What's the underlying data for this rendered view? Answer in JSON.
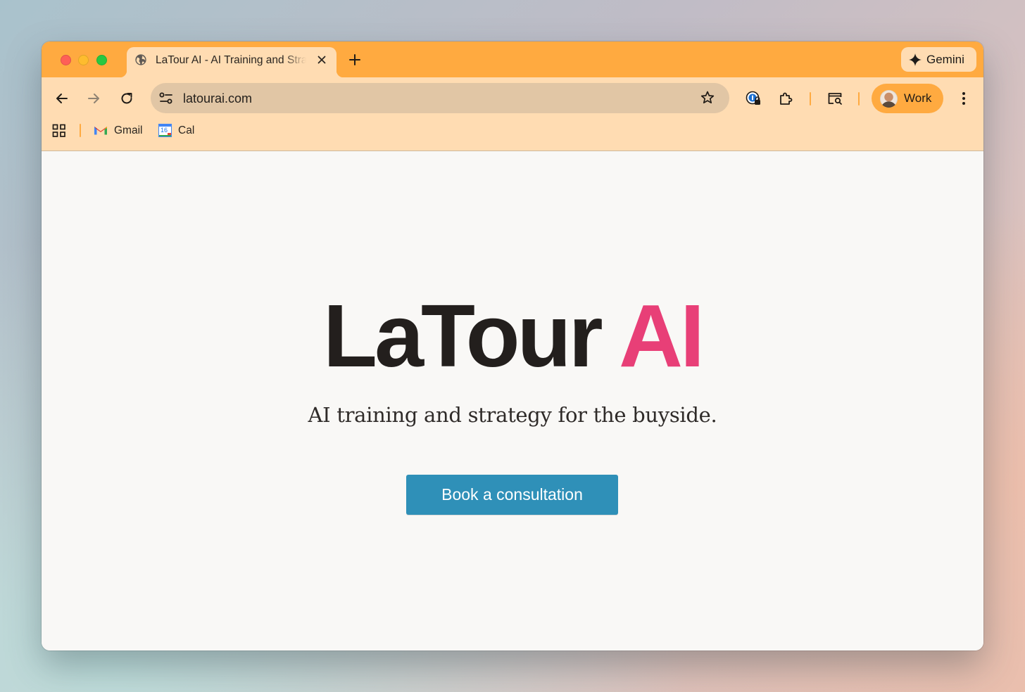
{
  "browser": {
    "tab": {
      "title": "LaTour AI - AI Training and Strategy",
      "favicon": "globe-icon"
    },
    "gemini_label": "Gemini",
    "address_bar": {
      "url": "latourai.com"
    },
    "profile_label": "Work",
    "bookmarks": [
      {
        "label": "Gmail",
        "icon": "gmail-icon"
      },
      {
        "label": "Cal",
        "icon": "calendar-icon",
        "icon_text": "16"
      }
    ],
    "colors": {
      "tabstrip": "#ffaa40",
      "toolbar": "#ffdcb2",
      "omnibox": "#e1c6a5"
    }
  },
  "page": {
    "hero": {
      "brand_main": "LaTour",
      "brand_accent": "AI"
    },
    "tagline": "AI training and strategy for the buyside.",
    "cta_label": "Book a consultation",
    "colors": {
      "accent": "#e83f77",
      "cta": "#2f90b8",
      "text": "#231f1d",
      "background": "#f9f8f6"
    }
  }
}
